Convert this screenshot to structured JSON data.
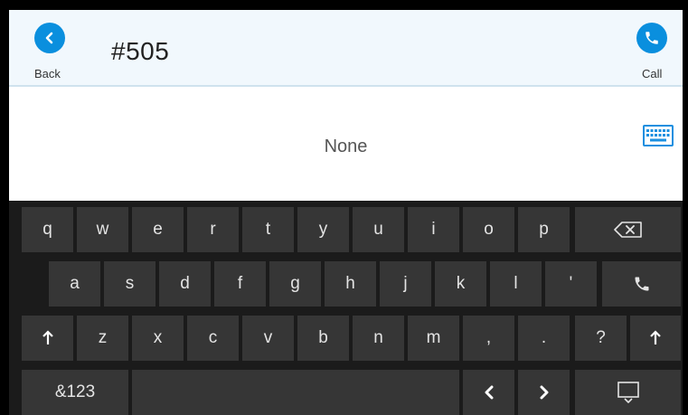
{
  "header": {
    "back_label": "Back",
    "call_label": "Call",
    "title": "#505"
  },
  "content": {
    "status_text": "None"
  },
  "keyboard": {
    "row1": [
      "q",
      "w",
      "e",
      "r",
      "t",
      "y",
      "u",
      "i",
      "o",
      "p"
    ],
    "row2": [
      "a",
      "s",
      "d",
      "f",
      "g",
      "h",
      "j",
      "k",
      "l",
      "'"
    ],
    "row3": [
      "z",
      "x",
      "c",
      "v",
      "b",
      "n",
      "m",
      ",",
      ".",
      "?"
    ],
    "symbols_label": "&123"
  },
  "icons": {
    "back": "chevron-left-icon",
    "call": "phone-icon",
    "keyboard_toggle": "keyboard-icon",
    "backspace": "backspace-icon",
    "shift": "arrow-up-icon",
    "cursor_left": "chevron-left-icon",
    "cursor_right": "chevron-right-icon",
    "hide_keyboard": "hide-keyboard-icon"
  },
  "colors": {
    "accent": "#0a8fde",
    "header_bg": "#f1f8fd",
    "key_bg": "#363636",
    "keyboard_bg": "#1b1b1b"
  }
}
